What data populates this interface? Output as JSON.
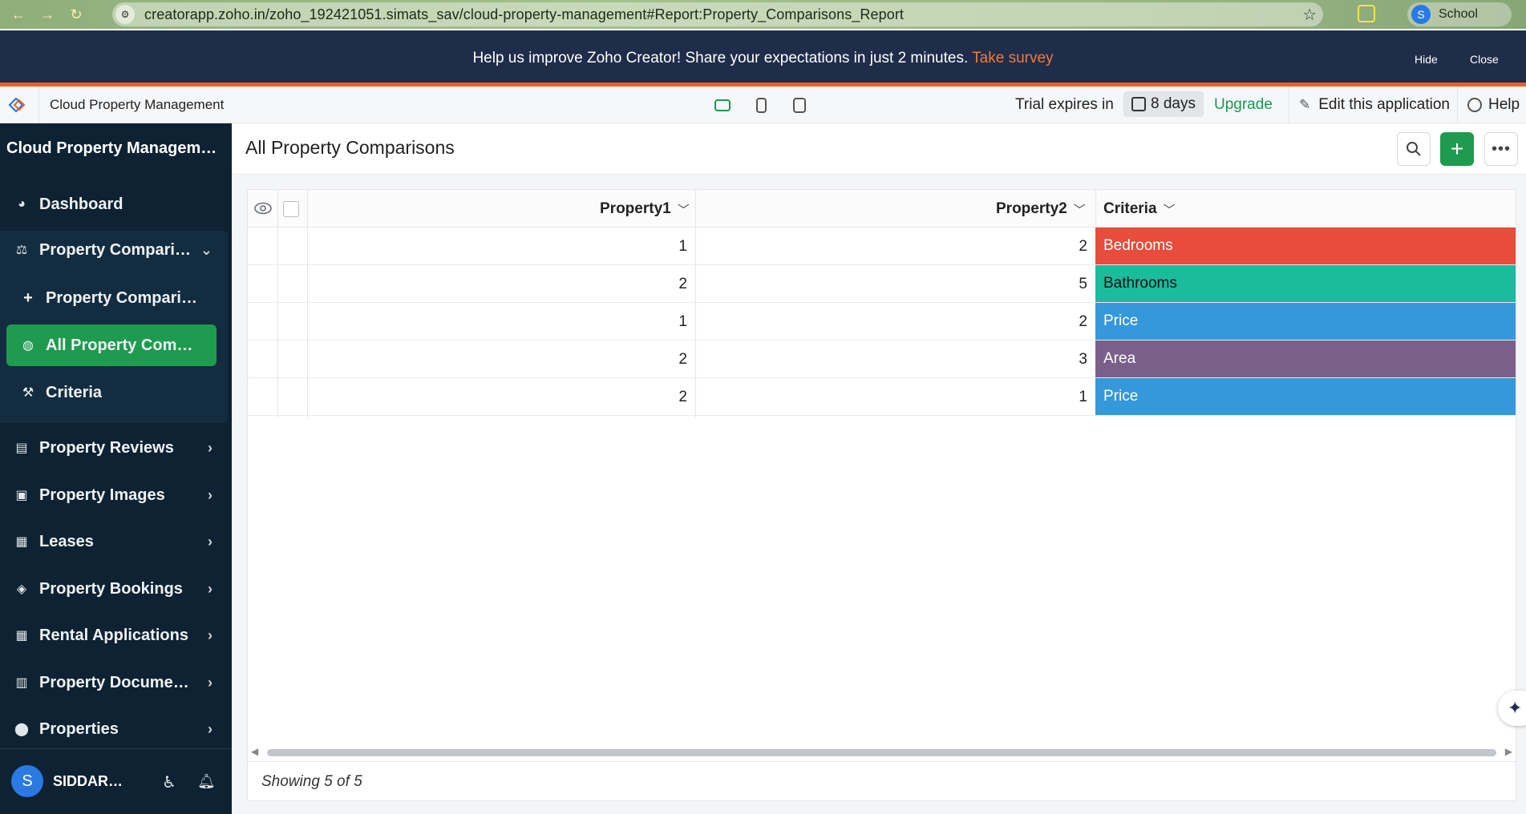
{
  "browser": {
    "url": "creatorapp.zoho.in/zoho_192421051.simats_sav/cloud-property-management#Report:Property_Comparisons_Report",
    "profile_initial": "S",
    "profile_label": "School"
  },
  "banner": {
    "message": "Help us improve Zoho Creator! Share your expectations in just 2 minutes.",
    "link": "Take survey",
    "hide": "Hide",
    "close": "Close"
  },
  "toolbar": {
    "app_name": "Cloud Property Management",
    "trial_text": "Trial expires in",
    "trial_days": "8 days",
    "upgrade": "Upgrade",
    "edit_app": "Edit this application",
    "help": "Help"
  },
  "sidebar": {
    "title": "Cloud Property Management",
    "dashboard": "Dashboard",
    "group": {
      "label": "Property Comparisons",
      "items": [
        {
          "label": "Property Comparisons"
        },
        {
          "label": "All Property Comparisons"
        },
        {
          "label": "Criteria"
        }
      ]
    },
    "sections": [
      {
        "label": "Property Reviews"
      },
      {
        "label": "Property Images"
      },
      {
        "label": "Leases"
      },
      {
        "label": "Property Bookings"
      },
      {
        "label": "Rental Applications"
      },
      {
        "label": "Property Documents"
      },
      {
        "label": "Properties"
      }
    ],
    "user": {
      "initial": "S",
      "name": "SIDDARTH"
    }
  },
  "report": {
    "title": "All Property Comparisons",
    "columns": [
      "Property1",
      "Property2",
      "Criteria"
    ],
    "rows": [
      {
        "property1": "1",
        "property2": "2",
        "criteria": "Bedrooms",
        "color": "#e74c3c"
      },
      {
        "property1": "2",
        "property2": "5",
        "criteria": "Bathrooms",
        "color": "#1abc9c"
      },
      {
        "property1": "1",
        "property2": "2",
        "criteria": "Price",
        "color": "#3498db"
      },
      {
        "property1": "2",
        "property2": "3",
        "criteria": "Area",
        "color": "#7a5f8a"
      },
      {
        "property1": "2",
        "property2": "1",
        "criteria": "Price",
        "color": "#3498db"
      }
    ],
    "footer": "Showing 5 of 5"
  },
  "colors": {
    "accent_green": "#1e9b4e",
    "sidebar_bg": "#0e2233",
    "banner_bg": "#1f2d4a",
    "banner_link": "#f07a3a"
  }
}
